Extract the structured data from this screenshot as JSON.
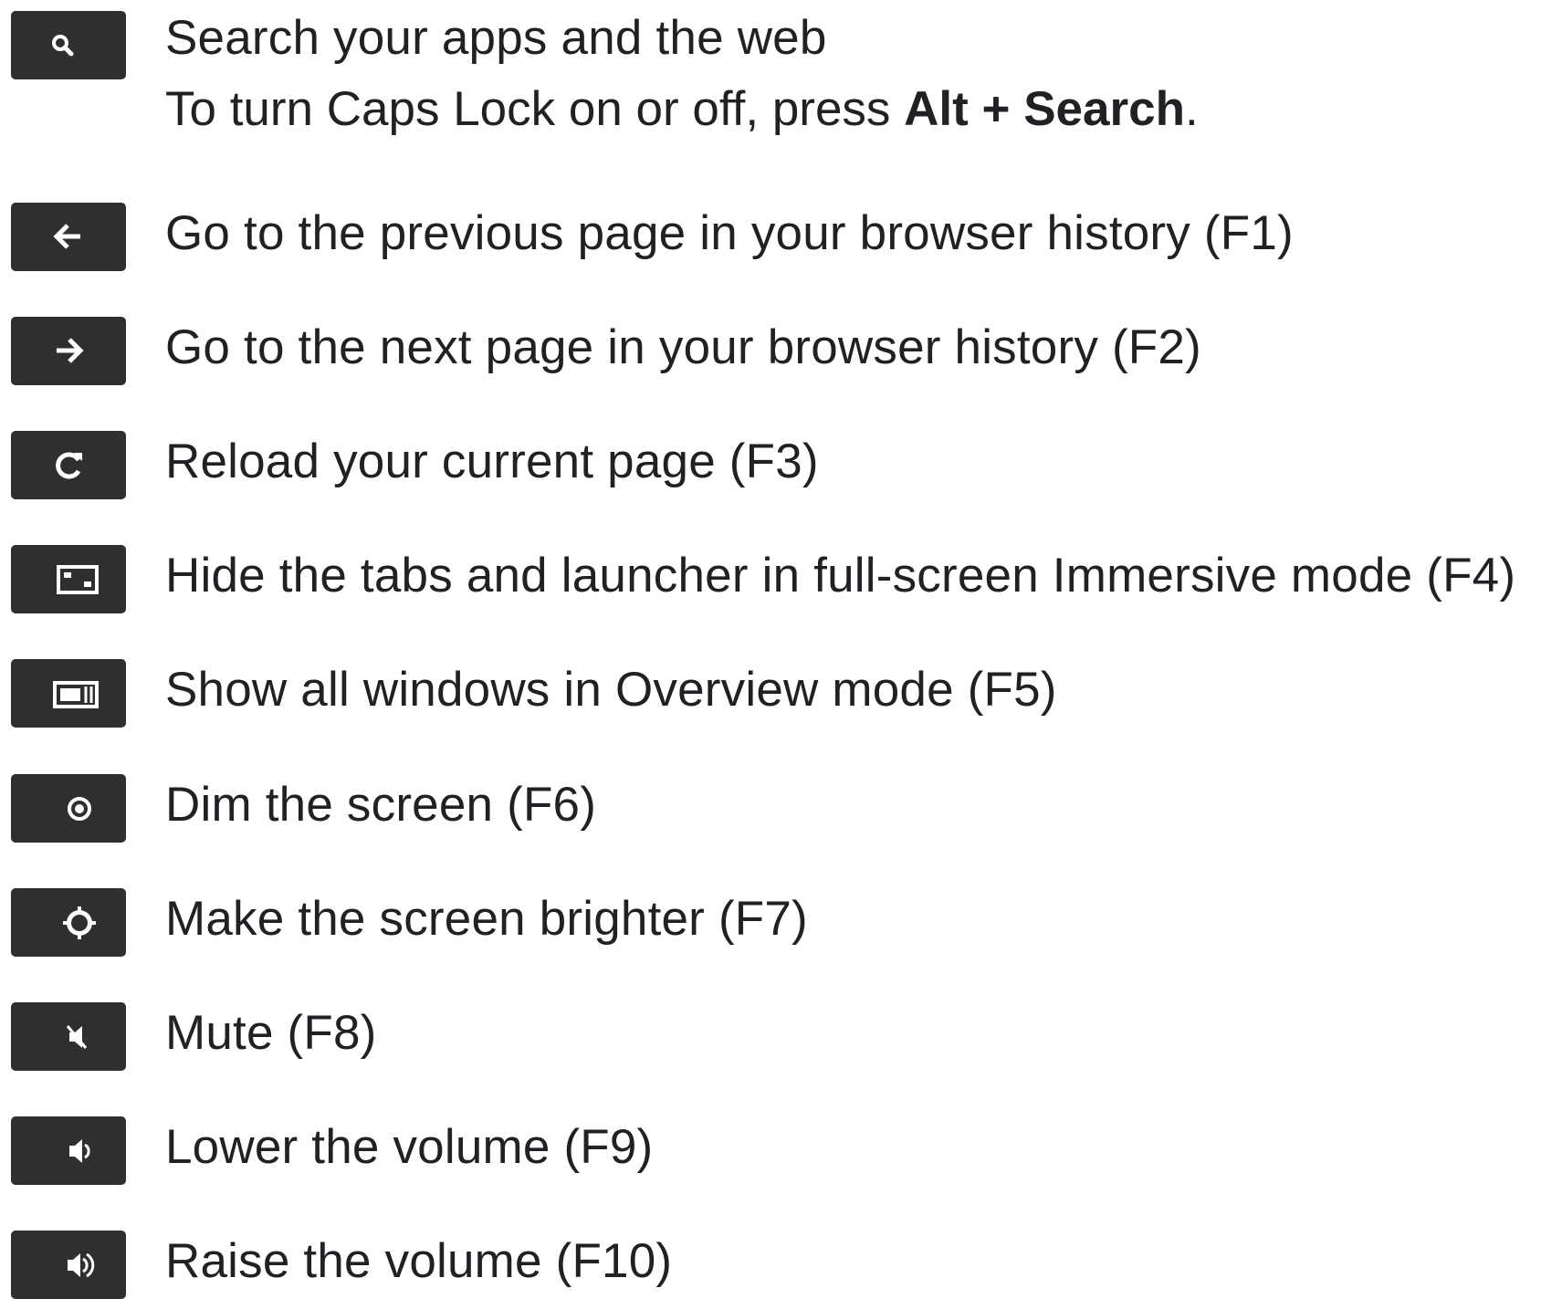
{
  "shortcuts": [
    {
      "icon": "search-icon",
      "text": "Search your apps and the web"
    },
    {
      "icon": "back-arrow-icon",
      "text": "Go to the previous page in your browser history (F1)"
    },
    {
      "icon": "forward-arrow-icon",
      "text": "Go to the next page in your browser history (F2)"
    },
    {
      "icon": "reload-icon",
      "text": "Reload your current page (F3)"
    },
    {
      "icon": "fullscreen-icon",
      "text": "Hide the tabs and launcher in full-screen Immersive mode (F4)"
    },
    {
      "icon": "overview-icon",
      "text": "Show all windows in Overview mode (F5)"
    },
    {
      "icon": "brightness-down-icon",
      "text": "Dim the screen (F6)"
    },
    {
      "icon": "brightness-up-icon",
      "text": "Make the screen brighter (F7)"
    },
    {
      "icon": "mute-icon",
      "text": "Mute (F8)"
    },
    {
      "icon": "volume-down-icon",
      "text": "Lower the volume (F9)"
    },
    {
      "icon": "volume-up-icon",
      "text": "Raise the volume (F10)"
    }
  ],
  "caps_lock_note": {
    "prefix": "To turn Caps Lock on or off, press ",
    "keys": "Alt + Search",
    "suffix": "."
  },
  "colors": {
    "key_background": "#2f2f2f",
    "icon": "#ffffff",
    "text": "#202124"
  }
}
